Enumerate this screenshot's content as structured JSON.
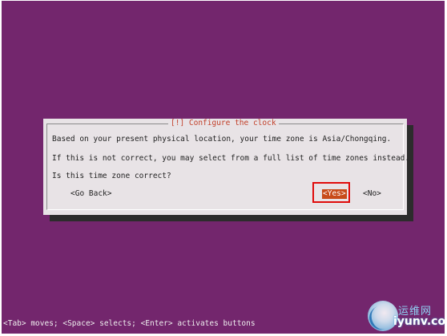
{
  "dialog": {
    "title": "[!] Configure the clock",
    "line1": "Based on your present physical location, your time zone is Asia/Chongqing.",
    "line2": "If this is not correct, you may select from a full list of time zones instead.",
    "line3": "Is this time zone correct?",
    "buttons": {
      "go_back": "<Go Back>",
      "yes": "<Yes>",
      "no": "<No>"
    }
  },
  "statusbar": {
    "text": "<Tab> moves; <Space> selects; <Enter> activates buttons"
  },
  "watermark": {
    "cn": "运维网",
    "en": "iyunv.com"
  },
  "colors": {
    "background": "#73266d",
    "dialog": "#e8e3e6",
    "title": "#c2402a",
    "focused_button": "#c84b1a",
    "highlight_outline": "#e00b0b"
  }
}
